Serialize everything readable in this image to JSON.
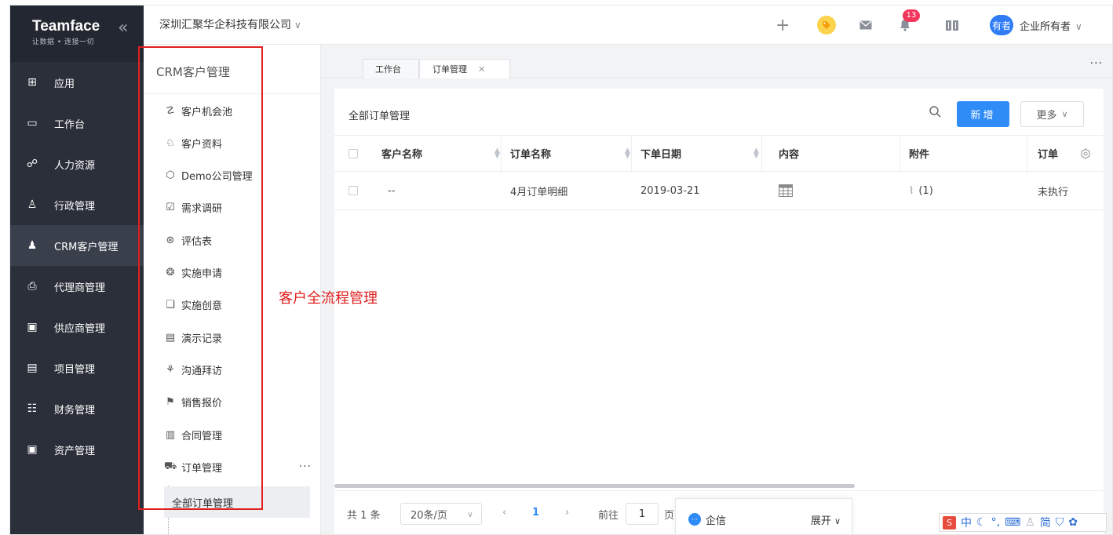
{
  "brand": {
    "logo": "Teamface",
    "slogan": "让数据 • 连接一切",
    "collapse_icon": "double-chevron-left"
  },
  "nav": {
    "items": [
      {
        "label": "应用",
        "icon": "grid-icon",
        "glyph": "⊞"
      },
      {
        "label": "工作台",
        "icon": "monitor-icon",
        "glyph": "▭"
      },
      {
        "label": "人力资源",
        "icon": "people-icon",
        "glyph": "☍"
      },
      {
        "label": "行政管理",
        "icon": "admin-icon",
        "glyph": "♙"
      },
      {
        "label": "CRM客户管理",
        "icon": "crm-icon",
        "glyph": "♟",
        "active": true
      },
      {
        "label": "代理商管理",
        "icon": "printer-icon",
        "glyph": "⎙"
      },
      {
        "label": "供应商管理",
        "icon": "supplier-icon",
        "glyph": "▣"
      },
      {
        "label": "项目管理",
        "icon": "project-icon",
        "glyph": "▤"
      },
      {
        "label": "财务管理",
        "icon": "finance-icon",
        "glyph": "☷"
      },
      {
        "label": "资产管理",
        "icon": "asset-icon",
        "glyph": "▣"
      }
    ]
  },
  "header": {
    "company": "深圳汇聚华企科技有限公司",
    "notification_count": "13",
    "avatar_text": "有者",
    "owner": "企业所有者"
  },
  "subnav": {
    "title": "CRM客户管理",
    "items": [
      {
        "label": "客户机会池",
        "glyph": "☡"
      },
      {
        "label": "客户资料",
        "glyph": "♘"
      },
      {
        "label": "Demo公司管理",
        "glyph": "⬡"
      },
      {
        "label": "需求调研",
        "glyph": "☑"
      },
      {
        "label": "评估表",
        "glyph": "⊛"
      },
      {
        "label": "实施申请",
        "glyph": "❂"
      },
      {
        "label": "实施创意",
        "glyph": "❏"
      },
      {
        "label": "演示记录",
        "glyph": "▤"
      },
      {
        "label": "沟通拜访",
        "glyph": "⚘"
      },
      {
        "label": "销售报价",
        "glyph": "⚑"
      },
      {
        "label": "合同管理",
        "glyph": "▥"
      },
      {
        "label": "订单管理",
        "glyph": "⛟"
      }
    ],
    "child": "全部订单管理",
    "more": "···"
  },
  "annotation": "客户全流程管理",
  "tabs": [
    {
      "label": "工作台"
    },
    {
      "label": "订单管理",
      "closable": true
    }
  ],
  "tabs_more": "···",
  "main": {
    "title": "全部订单管理",
    "new_button": "新增",
    "more_button": "更多",
    "columns": [
      "客户名称",
      "订单名称",
      "下单日期",
      "内容",
      "附件",
      "订单"
    ],
    "rows": [
      {
        "customer": "--",
        "order_name": "4月订单明细",
        "date": "2019-03-21",
        "attachment": "(1)",
        "status": "未执行"
      }
    ]
  },
  "pagination": {
    "total": "共 1 条",
    "page_size": "20条/页",
    "current": "1",
    "goto_label": "前往",
    "goto_value": "1",
    "page_unit": "页"
  },
  "qixin": {
    "label": "企信",
    "expand": "展开"
  },
  "ime": {
    "label_zh": "中",
    "label_simp": "简"
  }
}
